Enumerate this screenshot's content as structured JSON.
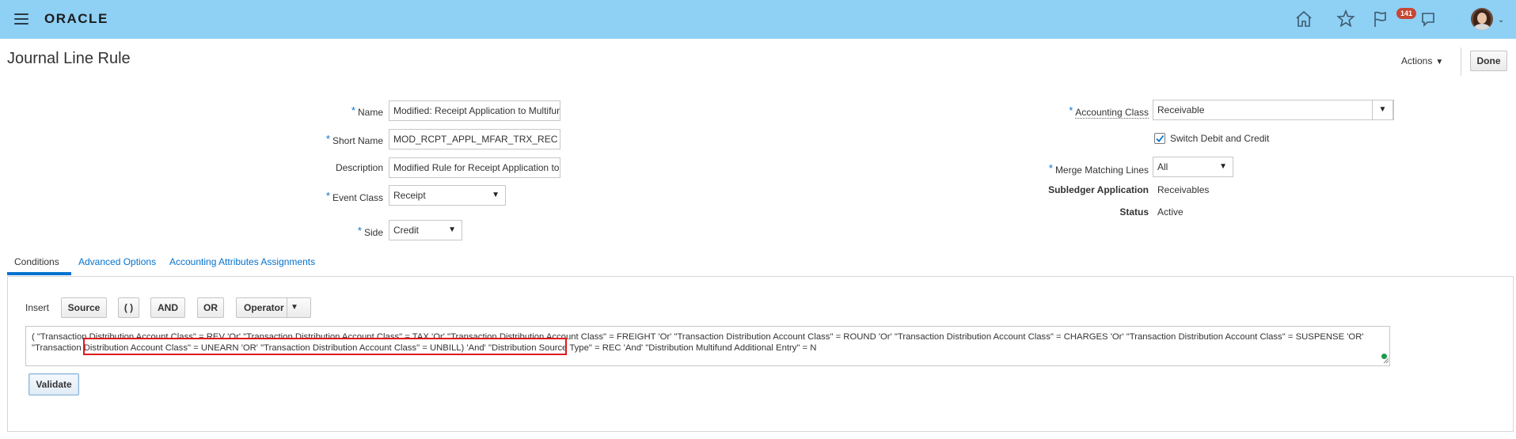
{
  "header": {
    "logo": "ORACLE",
    "notification_count": "141",
    "icons": [
      "hamburger-menu-icon",
      "home-icon",
      "star-icon",
      "flag-icon",
      "chat-icon",
      "avatar"
    ]
  },
  "page": {
    "title": "Journal Line Rule",
    "actions_label": "Actions",
    "done_label": "Done"
  },
  "form": {
    "name": {
      "label": "Name",
      "value": "Modified: Receipt Application to Multifund"
    },
    "short_name": {
      "label": "Short Name",
      "value": "MOD_RCPT_APPL_MFAR_TRX_REC"
    },
    "description": {
      "label": "Description",
      "value": "Modified Rule for Receipt Application to Multifund"
    },
    "event_class": {
      "label": "Event Class",
      "value": "Receipt"
    },
    "side": {
      "label": "Side",
      "value": "Credit"
    },
    "accounting_class": {
      "label": "Accounting Class",
      "value": "Receivable"
    },
    "switch_debit_credit": {
      "label": "Switch Debit and Credit",
      "checked": true
    },
    "merge_matching_lines": {
      "label": "Merge Matching Lines",
      "value": "All"
    },
    "subledger_application": {
      "label": "Subledger Application",
      "value": "Receivables"
    },
    "status": {
      "label": "Status",
      "value": "Active"
    }
  },
  "tabs": [
    {
      "label": "Conditions",
      "active": true
    },
    {
      "label": "Advanced Options",
      "active": false
    },
    {
      "label": "Accounting Attributes Assignments",
      "active": false
    }
  ],
  "conditions": {
    "insert_label": "Insert",
    "buttons": {
      "source": "Source",
      "parens": "( )",
      "and": "AND",
      "or": "OR",
      "operator": "Operator"
    },
    "expression": " ( \"Transaction Distribution Account Class\" = REV 'Or' \"Transaction Distribution Account Class\" = TAX 'Or' \"Transaction Distribution Account Class\" = FREIGHT 'Or' \"Transaction Distribution Account Class\" = ROUND 'Or' \"Transaction Distribution Account Class\" = CHARGES 'Or' \"Transaction Distribution Account Class\" = SUSPENSE 'OR' \"Transaction Distribution Account Class\" = UNEARN 'OR' \"Transaction Distribution Account Class\" = UNBILL) 'And' \"Distribution Source Type\" = REC 'And' \"Distribution Multifund Additional Entry\" = N",
    "validate_label": "Validate",
    "highlight_color": "#e0191e"
  },
  "colors": {
    "header_bg": "#8fd0f5",
    "link": "#0572ce",
    "badge": "#c74634"
  }
}
